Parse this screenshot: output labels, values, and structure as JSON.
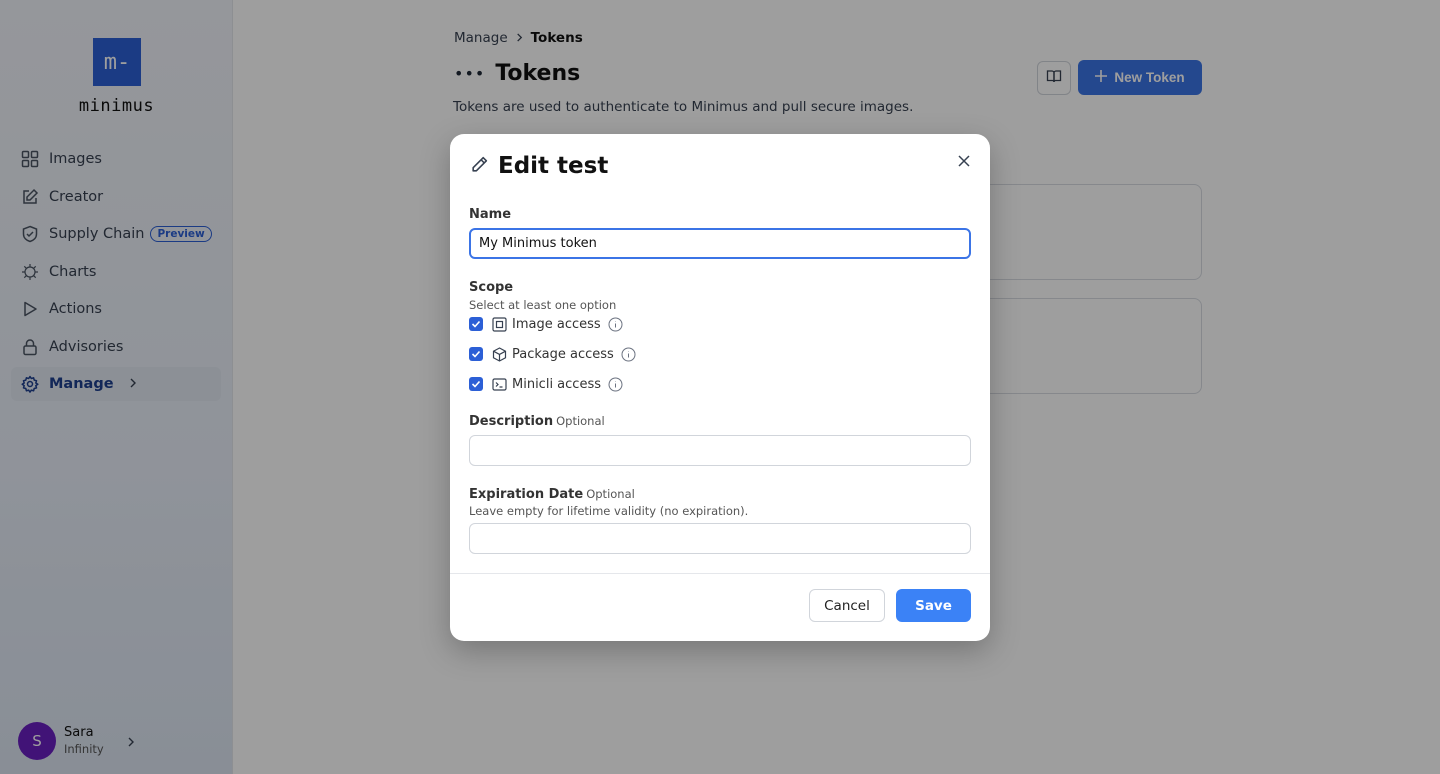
{
  "sidebar": {
    "logo_mark": "m-",
    "logo_text": "minimus",
    "items": [
      {
        "label": "Images",
        "icon": "grid-icon"
      },
      {
        "label": "Creator",
        "icon": "pencil-square-icon"
      },
      {
        "label": "Supply Chain",
        "icon": "shield-icon",
        "badge": "Preview"
      },
      {
        "label": "Charts",
        "icon": "helm-icon"
      },
      {
        "label": "Actions",
        "icon": "play-icon"
      },
      {
        "label": "Advisories",
        "icon": "lock-icon"
      },
      {
        "label": "Manage",
        "icon": "gear-icon",
        "active": true
      }
    ],
    "user": {
      "initial": "S",
      "name": "Sara",
      "org": "Infinity"
    }
  },
  "breadcrumb": {
    "parent": "Manage",
    "current": "Tokens"
  },
  "page": {
    "title": "Tokens",
    "description": "Tokens are used to authenticate to Minimus and pull secure images.",
    "new_button": "New Token"
  },
  "modal": {
    "title": "Edit test",
    "name_label": "Name",
    "name_value": "My Minimus token",
    "scope_label": "Scope",
    "scope_hint": "Select at least one option",
    "scopes": [
      {
        "label": "Image access",
        "checked": true,
        "icon": "image-square-icon"
      },
      {
        "label": "Package access",
        "checked": true,
        "icon": "package-cube-icon"
      },
      {
        "label": "Minicli access",
        "checked": true,
        "icon": "terminal-icon"
      }
    ],
    "description_label": "Description",
    "optional": "Optional",
    "description_value": "",
    "expiration_label": "Expiration Date",
    "expiration_hint": "Leave empty for lifetime validity (no expiration).",
    "expiration_value": "",
    "cancel": "Cancel",
    "save": "Save"
  },
  "colors": {
    "accent": "#3b74e6",
    "checkbox": "#2c5fd6",
    "avatar": "#6a1fc1"
  }
}
